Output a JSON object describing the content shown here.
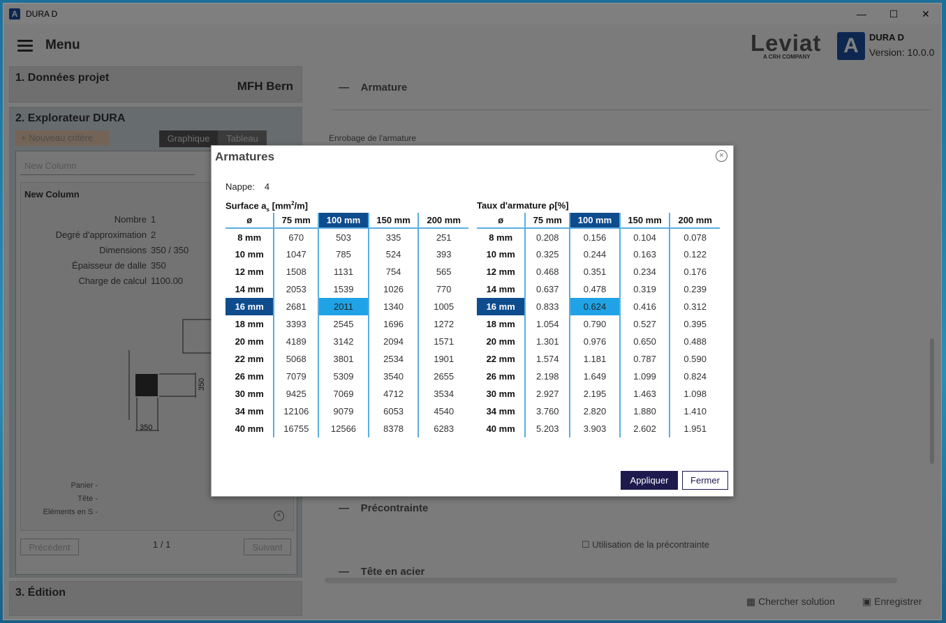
{
  "window": {
    "title": "DURA D",
    "minimize": "—",
    "maximize": "☐",
    "close": "✕"
  },
  "appbar": {
    "menu": "Menu",
    "brand": "Leviat",
    "brand_sub": "A CRH COMPANY",
    "logo_letter": "A",
    "product": "DURA D",
    "version": "Version: 10.0.0"
  },
  "left": {
    "p1_title": "1. Données projet",
    "p1_value": "MFH Bern",
    "p2_title": "2. Explorateur DURA",
    "new_criteria": "+ Nouveau critère",
    "tab_graph": "Graphique",
    "tab_table": "Tableau",
    "column_select": "New Column",
    "card_title": "New Column",
    "props": [
      {
        "k": "Nombre",
        "v": "1"
      },
      {
        "k": "Degré d'approximation",
        "v": "2"
      },
      {
        "k": "Dimensions",
        "v": "350 / 350"
      },
      {
        "k": "Épaisseur de dalle",
        "v": "350"
      },
      {
        "k": "Charge de calcul",
        "v": "1100.00"
      }
    ],
    "dim_v": "350",
    "dim_h": "350",
    "bottom_props": [
      {
        "k": "Panier",
        "v": "-"
      },
      {
        "k": "Tête",
        "v": "-"
      },
      {
        "k": "Eléments en S",
        "v": "-"
      }
    ],
    "prev": "Précédent",
    "pager": "1 / 1",
    "next": "Suivant",
    "p3_title": "3. Édition"
  },
  "right": {
    "armature": "Armature",
    "enrobage": "Enrobage de l'armature",
    "precontrainte": "Précontrainte",
    "utilisation": "Utilisation de la précontrainte",
    "tete": "Tête en acier",
    "chercher": "Chercher solution",
    "enregistrer": "Enregistrer"
  },
  "dialog": {
    "title": "Armatures",
    "close": "×",
    "nappe_label": "Nappe:",
    "nappe_value": "4",
    "surface_title": "Surface a",
    "surface_sub": "s",
    "surface_unit_a": " [mm",
    "surface_sup": "2",
    "surface_unit_b": "/m]",
    "taux_title": "Taux d'armature ρ[%]",
    "col_diam": "ø",
    "cols": [
      "75 mm",
      "100 mm",
      "150 mm",
      "200 mm"
    ],
    "rows": [
      "8 mm",
      "10 mm",
      "12 mm",
      "14 mm",
      "16 mm",
      "18 mm",
      "20 mm",
      "22 mm",
      "26 mm",
      "30 mm",
      "34 mm",
      "40 mm"
    ],
    "surface": [
      [
        "670",
        "503",
        "335",
        "251"
      ],
      [
        "1047",
        "785",
        "524",
        "393"
      ],
      [
        "1508",
        "1131",
        "754",
        "565"
      ],
      [
        "2053",
        "1539",
        "1026",
        "770"
      ],
      [
        "2681",
        "2011",
        "1340",
        "1005"
      ],
      [
        "3393",
        "2545",
        "1696",
        "1272"
      ],
      [
        "4189",
        "3142",
        "2094",
        "1571"
      ],
      [
        "5068",
        "3801",
        "2534",
        "1901"
      ],
      [
        "7079",
        "5309",
        "3540",
        "2655"
      ],
      [
        "9425",
        "7069",
        "4712",
        "3534"
      ],
      [
        "12106",
        "9079",
        "6053",
        "4540"
      ],
      [
        "16755",
        "12566",
        "8378",
        "6283"
      ]
    ],
    "taux": [
      [
        "0.208",
        "0.156",
        "0.104",
        "0.078"
      ],
      [
        "0.325",
        "0.244",
        "0.163",
        "0.122"
      ],
      [
        "0.468",
        "0.351",
        "0.234",
        "0.176"
      ],
      [
        "0.637",
        "0.478",
        "0.319",
        "0.239"
      ],
      [
        "0.833",
        "0.624",
        "0.416",
        "0.312"
      ],
      [
        "1.054",
        "0.790",
        "0.527",
        "0.395"
      ],
      [
        "1.301",
        "0.976",
        "0.650",
        "0.488"
      ],
      [
        "1.574",
        "1.181",
        "0.787",
        "0.590"
      ],
      [
        "2.198",
        "1.649",
        "1.099",
        "0.824"
      ],
      [
        "2.927",
        "2.195",
        "1.463",
        "1.098"
      ],
      [
        "3.760",
        "2.820",
        "1.880",
        "1.410"
      ],
      [
        "5.203",
        "3.903",
        "2.602",
        "1.951"
      ]
    ],
    "selected_row": "16 mm",
    "selected_col": "100 mm",
    "apply": "Appliquer",
    "close_btn": "Fermer"
  },
  "colors": {
    "selected_dark": "#0e4c8e",
    "selected_light": "#20a3e6",
    "apply_bg": "#1e1a4e"
  }
}
